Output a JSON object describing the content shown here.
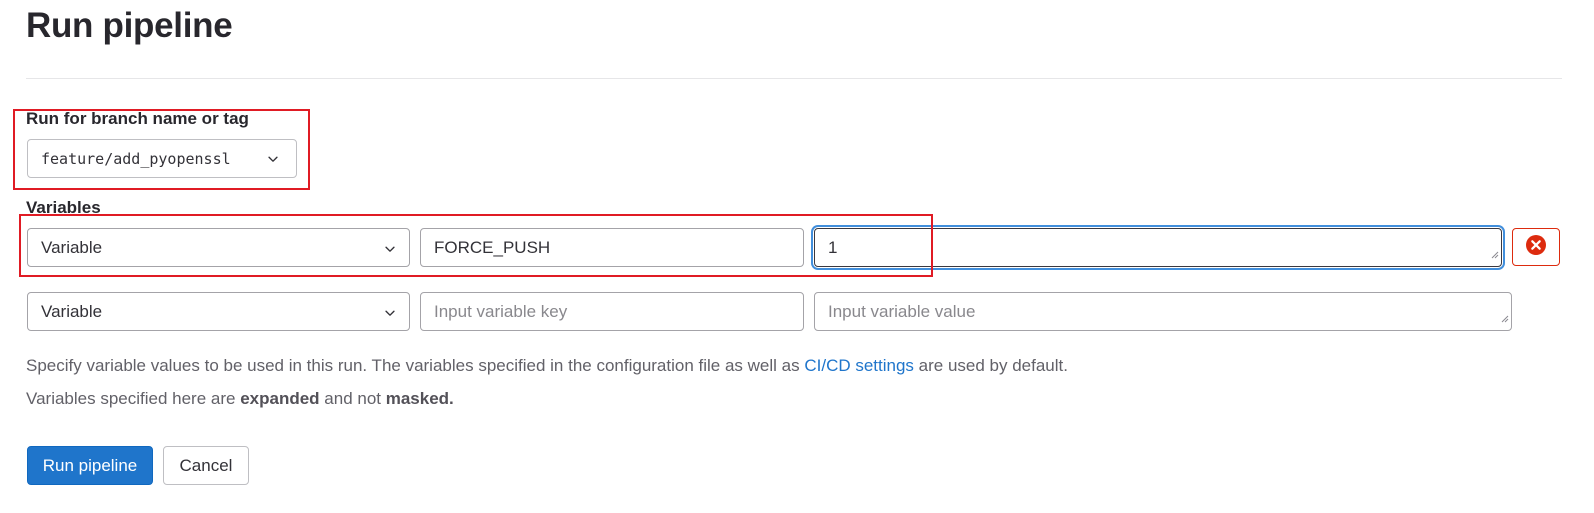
{
  "page": {
    "title": "Run pipeline"
  },
  "ref": {
    "label": "Run for branch name or tag",
    "value": "feature/add_pyopenssl",
    "icon": "chevron-down-icon"
  },
  "variables": {
    "label": "Variables",
    "rows": [
      {
        "type": "Variable",
        "key": "FORCE_PUSH",
        "value": "1",
        "remove_icon": "remove-circle-icon"
      },
      {
        "type": "Variable",
        "key_placeholder": "Input variable key",
        "value_placeholder": "Input variable value"
      }
    ]
  },
  "help": {
    "line1_before": "Specify variable values to be used in this run. The variables specified in the configuration file as well as ",
    "line1_link": "CI/CD settings",
    "line1_after": " are used by default.",
    "line2_before": "Variables specified here are ",
    "line2_bold1": "expanded",
    "line2_middle": " and not ",
    "line2_bold2": "masked."
  },
  "actions": {
    "run_label": "Run pipeline",
    "cancel_label": "Cancel"
  },
  "colors": {
    "primary": "#1f75cb",
    "danger": "#dd2b0e",
    "focus_ring": "#428fdc",
    "annotation": "#e01b24"
  }
}
